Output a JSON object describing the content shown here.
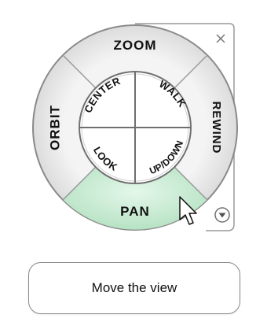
{
  "wheel": {
    "outer": {
      "zoom": "ZOOM",
      "rewind": "REWIND",
      "pan": "PAN",
      "orbit": "ORBIT"
    },
    "inner": {
      "center": "CENTER",
      "walk": "WALK",
      "look": "LOOK",
      "up_down": "UP/DOWN"
    },
    "highlighted": "PAN",
    "highlight_color": "#c9ecd4"
  },
  "tooltip": {
    "text": "Move the view"
  },
  "icons": {
    "close": "close-icon",
    "menu": "menu-arrow-icon",
    "cursor": "cursor-arrow-icon"
  }
}
